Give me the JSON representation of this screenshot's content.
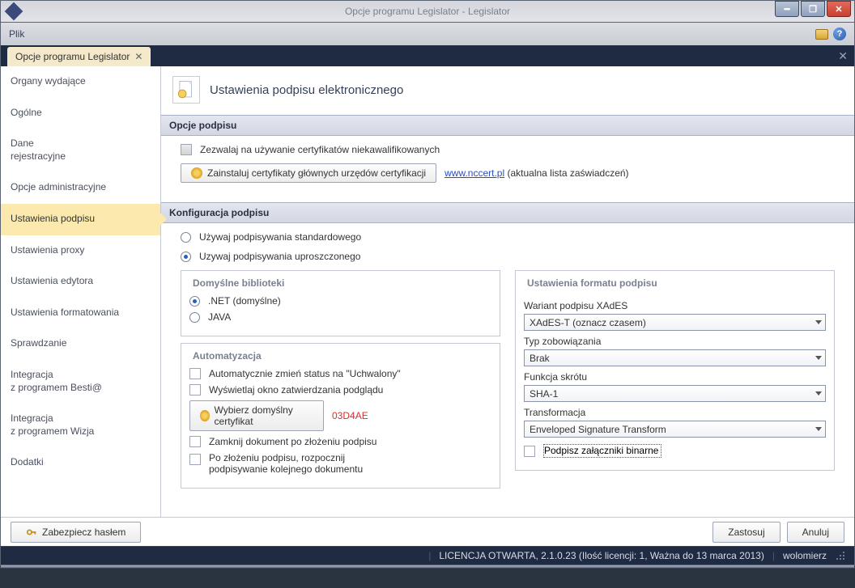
{
  "titlebar": {
    "title": "Opcje programu Legislator - Legislator"
  },
  "menubar": {
    "file": "Plik"
  },
  "tabstrip": {
    "tab_label": "Opcje programu Legislator"
  },
  "sidebar": {
    "items": [
      "Organy wydające",
      "Ogólne",
      "Dane\nrejestracyjne",
      "Opcje administracyjne",
      "Ustawienia podpisu",
      "Ustawienia proxy",
      "Ustawienia edytora",
      "Ustawienia formatowania",
      "Sprawdzanie",
      "Integracja\nz programem Besti@",
      "Integracja\nz programem Wizja",
      "Dodatki"
    ],
    "active_index": 4
  },
  "page": {
    "title": "Ustawienia podpisu elektronicznego",
    "section_options": {
      "header": "Opcje podpisu",
      "allow_unqualified": "Zezwalaj na używanie certyfikatów niekawalifikowanych",
      "install_certs_btn": "Zainstaluj certyfikaty głównych urzędów certyfikacji",
      "link_text": "www.nccert.pl",
      "link_after": " (aktualna lista zaświadczeń)"
    },
    "section_config": {
      "header": "Konfiguracja podpisu",
      "radio_std": "Używaj podpisywania standardowego",
      "radio_simple": "Uzywaj podpisywania uproszczonego",
      "libs": {
        "legend": "Domyślne biblioteki",
        "net": ".NET (domyślne)",
        "java": "JAVA"
      },
      "auto": {
        "legend": "Automatyzacja",
        "chk_status": "Automatycznie zmień status na \"Uchwalony\"",
        "chk_confirm": "Wyświetlaj okno zatwierdzania podglądu",
        "btn_cert": "Wybierz domyślny certyfikat",
        "cert_thumb": "03D4AE",
        "chk_close": "Zamknij dokument po złożeniu podpisu",
        "chk_next": "Po złożeniu podpisu, rozpocznij podpisywanie kolejnego dokumentu"
      },
      "format": {
        "legend": "Ustawienia formatu podpisu",
        "variant_lbl": "Wariant podpisu XAdES",
        "variant_val": "XAdES-T (oznacz czasem)",
        "oblig_lbl": "Typ zobowiązania",
        "oblig_val": "Brak",
        "hash_lbl": "Funkcja skrótu",
        "hash_val": "SHA-1",
        "trans_lbl": "Transformacja",
        "trans_val": "Enveloped Signature Transform",
        "sign_binary": "Podpisz załączniki binarne"
      }
    }
  },
  "actions": {
    "protect": "Zabezpiecz hasłem",
    "apply": "Zastosuj",
    "cancel": "Anuluj"
  },
  "statusbar": {
    "license": "LICENCJA OTWARTA, 2.1.0.23 (Ilość licencji: 1, Ważna do 13 marca 2013)",
    "user": "wolomierz"
  }
}
